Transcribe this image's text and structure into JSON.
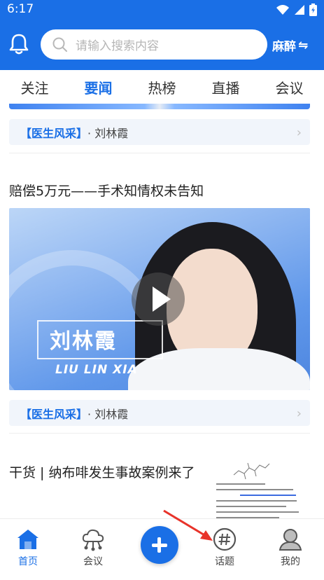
{
  "status": {
    "time": "6:17"
  },
  "header": {
    "search_placeholder": "请输入搜索内容",
    "department": "麻醉",
    "switch_glyph": "⇋"
  },
  "tabs": [
    {
      "label": "关注",
      "active": false
    },
    {
      "label": "要闻",
      "active": true
    },
    {
      "label": "热榜",
      "active": false
    },
    {
      "label": "直播",
      "active": false
    },
    {
      "label": "会议",
      "active": false
    }
  ],
  "feed": [
    {
      "tag": "【医生风采】",
      "author": "· 刘林霞"
    },
    {
      "title": "赔偿5万元——手术知情权未告知",
      "video": {
        "name_cn": "刘林霞",
        "name_pinyin": "LIU LIN XIA"
      },
      "tag": "【医生风采】",
      "author": "· 刘林霞"
    },
    {
      "title": "干货 | 纳布啡发生事故案例来了"
    }
  ],
  "bottom_nav": [
    {
      "label": "首页",
      "icon": "home-icon",
      "active": true
    },
    {
      "label": "会议",
      "icon": "cloud-network-icon",
      "active": false
    },
    {
      "label": "",
      "icon": "plus-icon",
      "active": false
    },
    {
      "label": "话题",
      "icon": "hashtag-icon",
      "active": false
    },
    {
      "label": "我的",
      "icon": "user-icon",
      "active": false
    }
  ],
  "colors": {
    "brand": "#1a6fe6",
    "arrow": "#e8332a"
  }
}
